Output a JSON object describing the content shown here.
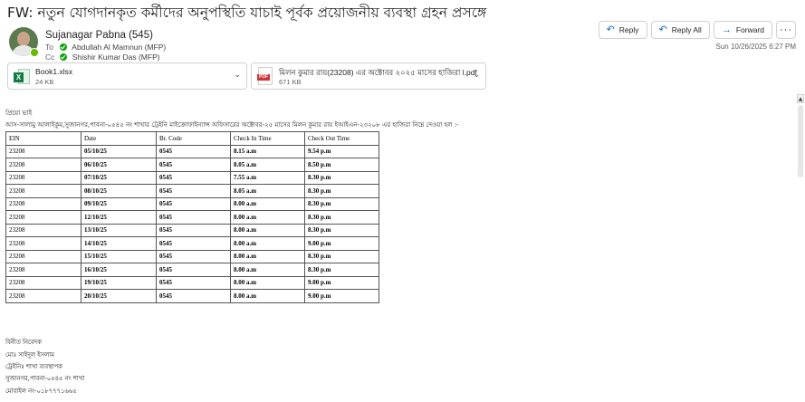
{
  "email": {
    "subject": "FW: নতুন যোগদানকৃত কর্মীদের অনুপস্থিতি যাচাই পূর্বক প্রয়োজনীয় ব্যবস্থা গ্রহন প্রসঙ্গে",
    "sender": "Sujanagar Pabna (545)",
    "to_label": "To",
    "to": "Abdullah Al Mamnun (MFP)",
    "cc_label": "Cc",
    "cc": "Shishir Kumar Das (MFP)",
    "datetime": "Sun 10/26/2025 6:27 PM"
  },
  "actions": {
    "reply": "Reply",
    "reply_all": "Reply All",
    "forward": "Forward",
    "more": "···"
  },
  "attachments": [
    {
      "name": "Book1.xlsx",
      "size": "24 KB",
      "icon": "excel-file-icon"
    },
    {
      "name": "মিলন কুমার রায়(23208) এর অক্টোবর ২০২৫ মাসের হাজিরা l.pdf",
      "size": "671 KB",
      "icon": "pdf-file-icon"
    }
  ],
  "body": {
    "greeting": "প্রিয়ো ভাই",
    "intro": "আস-সালামু আলাইকুম,সুজানগর,পাবনা-০৫৪৫ নং শাখার ট্রেইনি মাইক্রোফাইন্যান্স অফিসারের অক্টোবর-২৫ মাসের মিলন কুমার রায় ইআইএন-২৩২০৮ এর হাজিরা নিম্নে দেওয়া হল :-",
    "table": {
      "headers": [
        "EIN",
        "Date",
        "Br. Code",
        "Check In Time",
        "Check Out Time"
      ],
      "rows": [
        [
          "23208",
          "05/10/25",
          "0545",
          "8.15 a.m",
          "9.54 p.m"
        ],
        [
          "23208",
          "06/10/25",
          "0545",
          "8.05 a.m",
          "8.50 p.m"
        ],
        [
          "23208",
          "07/10/25",
          "0545",
          "7.55 a.m",
          "8.30 p.m"
        ],
        [
          "23208",
          "08/10/25",
          "0545",
          "8.05 a.m",
          "8.30 p.m"
        ],
        [
          "23208",
          "09/10/25",
          "0545",
          "8.00 a.m",
          "8.30 p.m"
        ],
        [
          "23208",
          "12/10/25",
          "0545",
          "8.00 a.m",
          "8.30 p.m"
        ],
        [
          "23208",
          "13/10/25",
          "0545",
          "8.00 a.m",
          "8.30 p.m"
        ],
        [
          "23208",
          "14/10/25",
          "0545",
          "8.00 a.m",
          "9.00 p.m"
        ],
        [
          "23208",
          "15/10/25",
          "0545",
          "8.00 a.m",
          "8.30 p.m"
        ],
        [
          "23208",
          "16/10/25",
          "0545",
          "8.00 a.m",
          "8.30 p.m"
        ],
        [
          "23208",
          "19/10/25",
          "0545",
          "8.00 a.m",
          "9.00 p.m"
        ],
        [
          "23208",
          "20/10/25",
          "0545",
          "8.00 a.m",
          "9.00 p.m"
        ]
      ]
    },
    "signature": [
      "বিনীত নিবেদক",
      "মোঃ সাইদুল ইসলাম",
      "ট্রেইনিঃ শাখা ব্যবস্থাপক",
      "সুজানগর,পাবনা-০৫৪৫ নং শাখা",
      "মোবাইল নং-০১৮৭৭৭১৬৬৫"
    ]
  },
  "colors": {
    "accent": "#0f6cbd",
    "presence": "#6bb700",
    "excel": "#107c41",
    "pdf": "#d13438"
  }
}
